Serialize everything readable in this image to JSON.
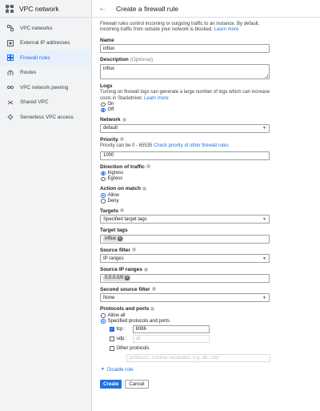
{
  "sidebar": {
    "title": "VPC network",
    "items": [
      {
        "label": "VPC networks",
        "icon": "vpc-icon"
      },
      {
        "label": "External IP addresses",
        "icon": "ip-icon"
      },
      {
        "label": "Firewall rules",
        "icon": "firewall-icon",
        "active": true
      },
      {
        "label": "Routes",
        "icon": "routes-icon"
      },
      {
        "label": "VPC network peering",
        "icon": "peering-icon"
      },
      {
        "label": "Shared VPC",
        "icon": "shared-vpc-icon"
      },
      {
        "label": "Serverless VPC access",
        "icon": "serverless-icon"
      }
    ]
  },
  "header": {
    "title": "Create a firewall rule"
  },
  "intro": {
    "text": "Firewall rules control incoming or outgoing traffic to an instance. By default, incoming traffic from outside your network is blocked.",
    "link": "Learn more"
  },
  "name": {
    "label": "Name",
    "value": "influx"
  },
  "description": {
    "label": "Description",
    "optional": "(Optional)",
    "value": "influx"
  },
  "logs": {
    "label": "Logs",
    "text": "Turning on firewall logs can generate a large number of logs which can increase costs in Stackdriver.",
    "link": "Learn more",
    "on": "On",
    "off": "Off"
  },
  "network": {
    "label": "Network",
    "value": "default"
  },
  "priority": {
    "label": "Priority",
    "help": "Priority can be 0 - 65535",
    "link": "Check priority of other firewall rules",
    "value": "1000"
  },
  "direction": {
    "label": "Direction of traffic",
    "ingress": "Ingress",
    "egress": "Egress"
  },
  "action": {
    "label": "Action on match",
    "allow": "Allow",
    "deny": "Deny"
  },
  "targets": {
    "label": "Targets",
    "value": "Specified target tags"
  },
  "target_tags": {
    "label": "Target tags",
    "chip": "influx"
  },
  "source_filter": {
    "label": "Source filter",
    "value": "IP ranges"
  },
  "source_ip": {
    "label": "Source IP ranges",
    "chip": "0.0.0.0/0"
  },
  "second_source": {
    "label": "Second source filter",
    "value": "None"
  },
  "protocols": {
    "label": "Protocols and ports",
    "allow_all": "Allow all",
    "specified": "Specified protocols and ports",
    "tcp": {
      "label": "tcp :",
      "value": "8086"
    },
    "udp": {
      "label": "udp :",
      "placeholder": "all"
    },
    "other": {
      "label": "Other protocols",
      "placeholder": "protocols, comma separated, e.g. ah, sctp"
    }
  },
  "disable_rule": "Disable rule",
  "buttons": {
    "create": "Create",
    "cancel": "Cancel"
  },
  "colors": {
    "accent": "#1a73e8",
    "sidebar_bg": "#f1f3f4",
    "active_bg": "#e8f0fe"
  }
}
